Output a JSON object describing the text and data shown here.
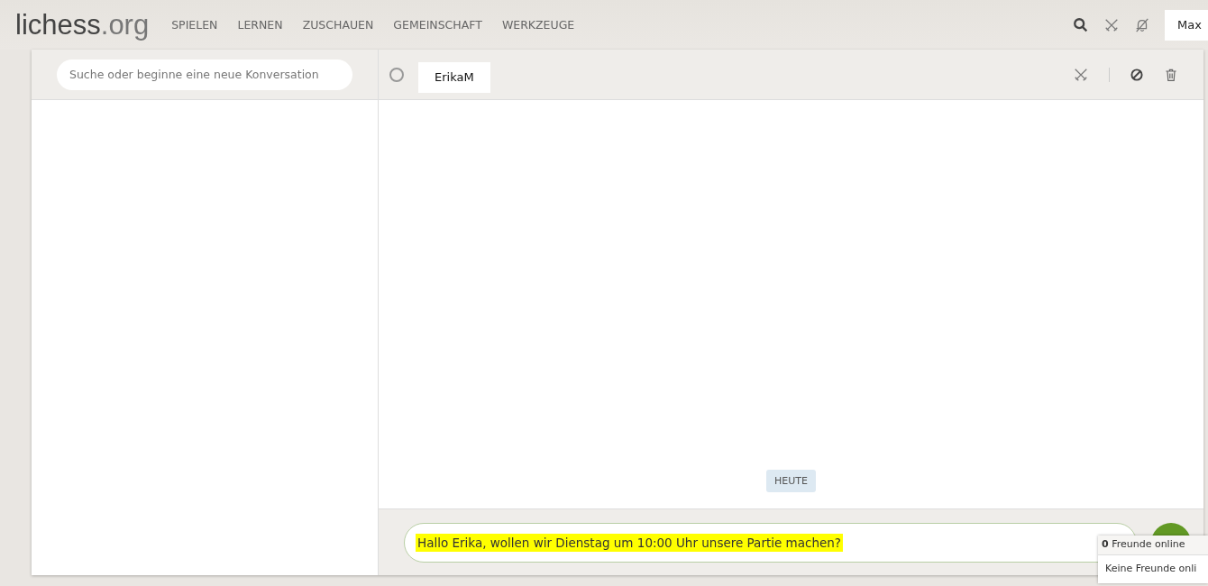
{
  "header": {
    "logo": {
      "name": "lichess",
      "tld": ".org"
    },
    "nav": [
      "SPIELEN",
      "LERNEN",
      "ZUSCHAUEN",
      "GEMEINSCHAFT",
      "WERKZEUGE"
    ],
    "user": "Max"
  },
  "sidebar": {
    "search": {
      "placeholder": "Suche oder beginne eine neue Konversation"
    }
  },
  "conversation": {
    "contact": "ErikaM",
    "online": false,
    "day_label": "HEUTE",
    "message": {
      "value": "Hallo Erika, wollen wir Dienstag um 10:00 Uhr unsere Partie machen?",
      "highlighted": true
    }
  },
  "friends": {
    "title": "**0** Freunde online",
    "empty": "Keine Freunde onli"
  }
}
